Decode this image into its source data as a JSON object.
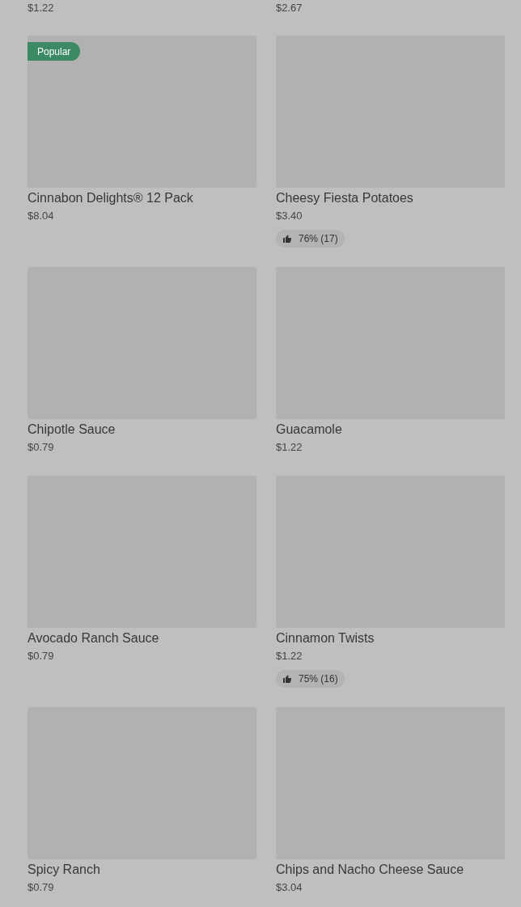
{
  "top_prices": [
    "$1.22",
    "$2.67"
  ],
  "items": [
    {
      "name": "Cinnabon Delights® 12 Pack",
      "price": "$8.04",
      "badge": "Popular"
    },
    {
      "name": "Cheesy Fiesta Potatoes",
      "price": "$3.40",
      "rating": "76% (17)"
    },
    {
      "name": "Chipotle Sauce",
      "price": "$0.79"
    },
    {
      "name": "Guacamole",
      "price": "$1.22"
    },
    {
      "name": "Avocado Ranch Sauce",
      "price": "$0.79"
    },
    {
      "name": "Cinnamon Twists",
      "price": "$1.22",
      "rating": "75% (16)"
    },
    {
      "name": "Spicy Ranch",
      "price": "$0.79"
    },
    {
      "name": "Chips and Nacho Cheese Sauce",
      "price": "$3.04"
    }
  ]
}
